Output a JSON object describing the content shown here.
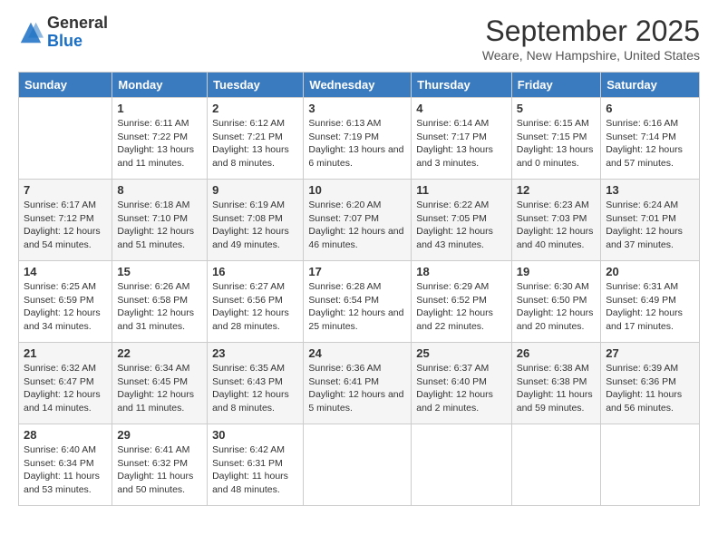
{
  "header": {
    "logo_general": "General",
    "logo_blue": "Blue",
    "month_title": "September 2025",
    "location": "Weare, New Hampshire, United States"
  },
  "days_of_week": [
    "Sunday",
    "Monday",
    "Tuesday",
    "Wednesday",
    "Thursday",
    "Friday",
    "Saturday"
  ],
  "weeks": [
    [
      {
        "day": "",
        "content": ""
      },
      {
        "day": "1",
        "content": "Sunrise: 6:11 AM\nSunset: 7:22 PM\nDaylight: 13 hours and 11 minutes."
      },
      {
        "day": "2",
        "content": "Sunrise: 6:12 AM\nSunset: 7:21 PM\nDaylight: 13 hours and 8 minutes."
      },
      {
        "day": "3",
        "content": "Sunrise: 6:13 AM\nSunset: 7:19 PM\nDaylight: 13 hours and 6 minutes."
      },
      {
        "day": "4",
        "content": "Sunrise: 6:14 AM\nSunset: 7:17 PM\nDaylight: 13 hours and 3 minutes."
      },
      {
        "day": "5",
        "content": "Sunrise: 6:15 AM\nSunset: 7:15 PM\nDaylight: 13 hours and 0 minutes."
      },
      {
        "day": "6",
        "content": "Sunrise: 6:16 AM\nSunset: 7:14 PM\nDaylight: 12 hours and 57 minutes."
      }
    ],
    [
      {
        "day": "7",
        "content": "Sunrise: 6:17 AM\nSunset: 7:12 PM\nDaylight: 12 hours and 54 minutes."
      },
      {
        "day": "8",
        "content": "Sunrise: 6:18 AM\nSunset: 7:10 PM\nDaylight: 12 hours and 51 minutes."
      },
      {
        "day": "9",
        "content": "Sunrise: 6:19 AM\nSunset: 7:08 PM\nDaylight: 12 hours and 49 minutes."
      },
      {
        "day": "10",
        "content": "Sunrise: 6:20 AM\nSunset: 7:07 PM\nDaylight: 12 hours and 46 minutes."
      },
      {
        "day": "11",
        "content": "Sunrise: 6:22 AM\nSunset: 7:05 PM\nDaylight: 12 hours and 43 minutes."
      },
      {
        "day": "12",
        "content": "Sunrise: 6:23 AM\nSunset: 7:03 PM\nDaylight: 12 hours and 40 minutes."
      },
      {
        "day": "13",
        "content": "Sunrise: 6:24 AM\nSunset: 7:01 PM\nDaylight: 12 hours and 37 minutes."
      }
    ],
    [
      {
        "day": "14",
        "content": "Sunrise: 6:25 AM\nSunset: 6:59 PM\nDaylight: 12 hours and 34 minutes."
      },
      {
        "day": "15",
        "content": "Sunrise: 6:26 AM\nSunset: 6:58 PM\nDaylight: 12 hours and 31 minutes."
      },
      {
        "day": "16",
        "content": "Sunrise: 6:27 AM\nSunset: 6:56 PM\nDaylight: 12 hours and 28 minutes."
      },
      {
        "day": "17",
        "content": "Sunrise: 6:28 AM\nSunset: 6:54 PM\nDaylight: 12 hours and 25 minutes."
      },
      {
        "day": "18",
        "content": "Sunrise: 6:29 AM\nSunset: 6:52 PM\nDaylight: 12 hours and 22 minutes."
      },
      {
        "day": "19",
        "content": "Sunrise: 6:30 AM\nSunset: 6:50 PM\nDaylight: 12 hours and 20 minutes."
      },
      {
        "day": "20",
        "content": "Sunrise: 6:31 AM\nSunset: 6:49 PM\nDaylight: 12 hours and 17 minutes."
      }
    ],
    [
      {
        "day": "21",
        "content": "Sunrise: 6:32 AM\nSunset: 6:47 PM\nDaylight: 12 hours and 14 minutes."
      },
      {
        "day": "22",
        "content": "Sunrise: 6:34 AM\nSunset: 6:45 PM\nDaylight: 12 hours and 11 minutes."
      },
      {
        "day": "23",
        "content": "Sunrise: 6:35 AM\nSunset: 6:43 PM\nDaylight: 12 hours and 8 minutes."
      },
      {
        "day": "24",
        "content": "Sunrise: 6:36 AM\nSunset: 6:41 PM\nDaylight: 12 hours and 5 minutes."
      },
      {
        "day": "25",
        "content": "Sunrise: 6:37 AM\nSunset: 6:40 PM\nDaylight: 12 hours and 2 minutes."
      },
      {
        "day": "26",
        "content": "Sunrise: 6:38 AM\nSunset: 6:38 PM\nDaylight: 11 hours and 59 minutes."
      },
      {
        "day": "27",
        "content": "Sunrise: 6:39 AM\nSunset: 6:36 PM\nDaylight: 11 hours and 56 minutes."
      }
    ],
    [
      {
        "day": "28",
        "content": "Sunrise: 6:40 AM\nSunset: 6:34 PM\nDaylight: 11 hours and 53 minutes."
      },
      {
        "day": "29",
        "content": "Sunrise: 6:41 AM\nSunset: 6:32 PM\nDaylight: 11 hours and 50 minutes."
      },
      {
        "day": "30",
        "content": "Sunrise: 6:42 AM\nSunset: 6:31 PM\nDaylight: 11 hours and 48 minutes."
      },
      {
        "day": "",
        "content": ""
      },
      {
        "day": "",
        "content": ""
      },
      {
        "day": "",
        "content": ""
      },
      {
        "day": "",
        "content": ""
      }
    ]
  ]
}
